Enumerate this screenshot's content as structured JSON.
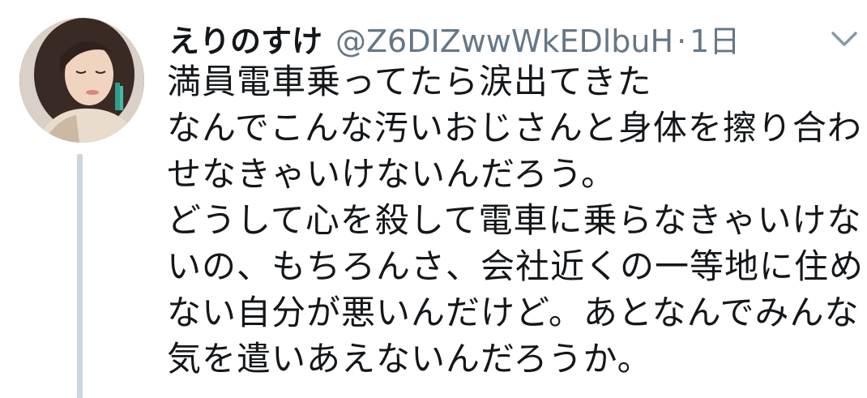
{
  "tweet": {
    "display_name": "えりのすけ",
    "handle": "@Z6DIZwwWkEDlbuH",
    "separator": "·",
    "time": "1日",
    "lines": [
      "満員電車乗ってたら涙出てきた",
      "なんでこんな汚いおじさんと身体を擦り合わ",
      "せなきゃいけないんだろう。",
      "どうして心を殺して電車に乗らなきゃいけな",
      "いの、もちろんさ、会社近くの一等地に住め",
      "ない自分が悪いんだけど。あとなんでみんな",
      "気を遣いあえないんだろうか。"
    ]
  },
  "icons": {
    "more": "chevron-down-icon"
  },
  "colors": {
    "text": "#14171a",
    "secondary": "#657786",
    "thread_line": "#ccd6dd",
    "background": "#ffffff"
  }
}
